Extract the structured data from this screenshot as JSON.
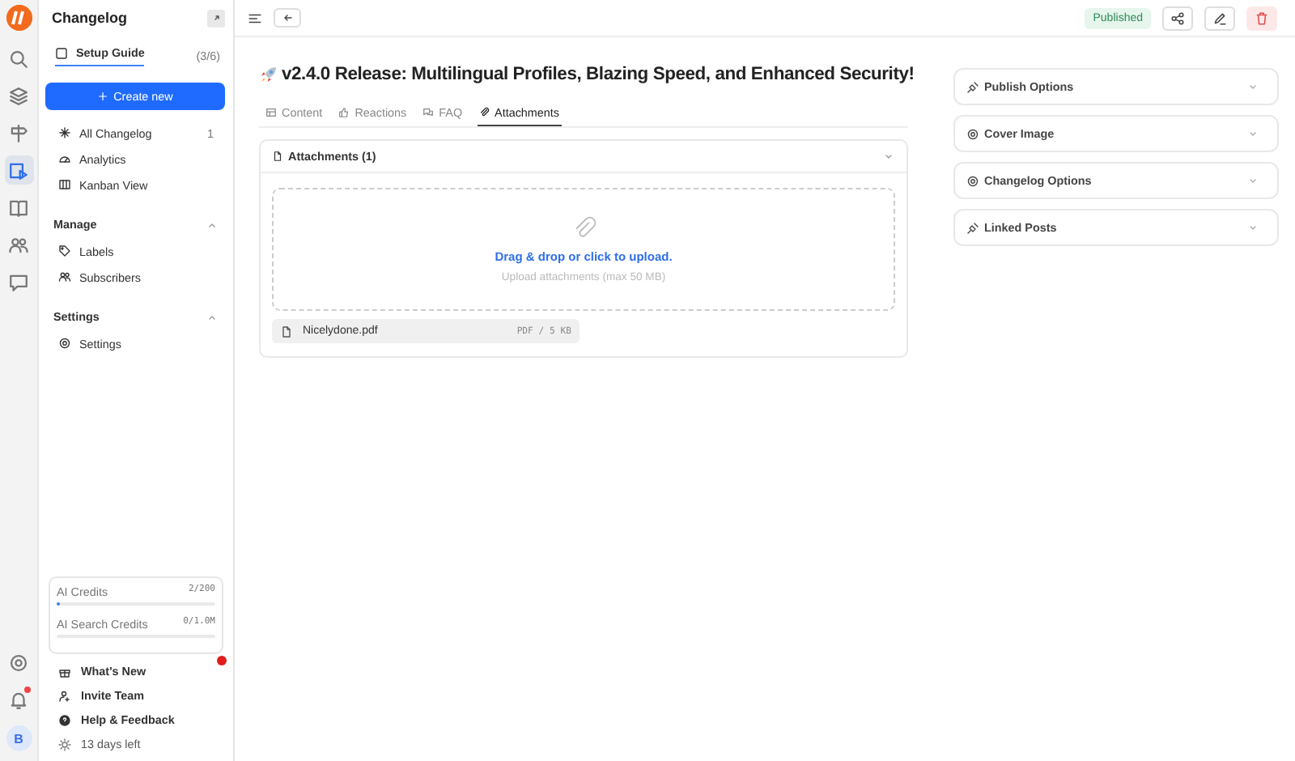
{
  "rail": {
    "items": [
      {
        "kind": "search",
        "selected": false
      },
      {
        "kind": "layers",
        "selected": false
      },
      {
        "kind": "signpost",
        "selected": false
      },
      {
        "kind": "changelog",
        "selected": true
      },
      {
        "kind": "book",
        "selected": false
      },
      {
        "kind": "users",
        "selected": false
      },
      {
        "kind": "chat",
        "selected": false
      }
    ],
    "bottom": [
      {
        "kind": "settings",
        "badge": false
      },
      {
        "kind": "bell",
        "badge": true
      }
    ],
    "avatar": "B"
  },
  "sidebar": {
    "title": "Changelog",
    "setup_guide": {
      "label": "Setup Guide",
      "progress": "(3/6)"
    },
    "create_button": "Create new",
    "items": [
      {
        "kind": "star",
        "label": "All Changelog",
        "count": "1"
      },
      {
        "kind": "analytics",
        "label": "Analytics"
      },
      {
        "kind": "kanban",
        "label": "Kanban View"
      }
    ],
    "sections": [
      {
        "title": "Manage",
        "expanded": true,
        "items": [
          {
            "kind": "tag",
            "label": "Labels"
          },
          {
            "kind": "users",
            "label": "Subscribers"
          }
        ]
      },
      {
        "title": "Settings",
        "expanded": true,
        "items": [
          {
            "kind": "settings",
            "label": "Settings"
          }
        ]
      }
    ],
    "credits": [
      {
        "label": "AI Credits",
        "value": "2/200",
        "level": 0.01
      },
      {
        "label": "AI Search Credits",
        "value": "0/1.0M"
      }
    ],
    "footer": [
      {
        "kind": "gift",
        "label": "What's New",
        "badge": true
      },
      {
        "kind": "invite",
        "label": "Invite Team",
        "badge": false
      },
      {
        "kind": "help",
        "label": "Help & Feedback",
        "badge": false
      }
    ],
    "trial": "13 days left"
  },
  "header": {
    "status": "Published",
    "actions": [
      {
        "kind": "share"
      },
      {
        "kind": "edit"
      },
      {
        "kind": "delete"
      }
    ]
  },
  "post": {
    "title": "v2.4.0 Release: Multilingual Profiles, Blazing Speed, and Enhanced Security!",
    "tabs": [
      {
        "kind": "content",
        "label": "Content",
        "selected": false
      },
      {
        "kind": "reactions",
        "label": "Reactions",
        "selected": false
      },
      {
        "kind": "faq",
        "label": "FAQ",
        "selected": false
      },
      {
        "kind": "attach",
        "label": "Attachments",
        "selected": true
      }
    ],
    "attachments": {
      "title": "Attachments (1)",
      "expanded": true,
      "drop_link": "Drag & drop or click to upload.",
      "hint": "Upload attachments (max 50 MB)",
      "files": [
        {
          "name": "Nicelydone.pdf",
          "meta": "PDF / 5 KB"
        }
      ]
    }
  },
  "options": [
    {
      "kind": "plug",
      "label": "Publish Options",
      "expanded": false
    },
    {
      "kind": "settings",
      "label": "Cover Image",
      "expanded": false
    },
    {
      "kind": "settings",
      "label": "Changelog Options",
      "expanded": false
    },
    {
      "kind": "plug",
      "label": "Linked Posts",
      "expanded": false
    }
  ]
}
